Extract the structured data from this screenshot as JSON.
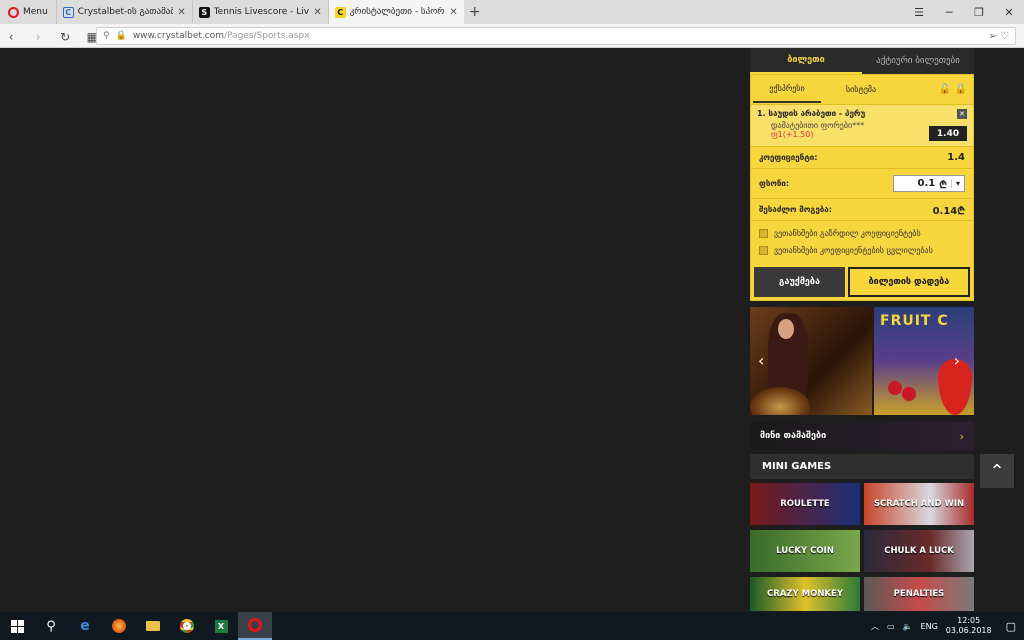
{
  "browser": {
    "menu_label": "Menu",
    "tabs": [
      {
        "title": "Crystalbet-ის გათამაშე",
        "icon": "crystalbet-favicon"
      },
      {
        "title": "Tennis Livescore - Live Sco",
        "icon": "livescore-favicon"
      },
      {
        "title": "კრისტალბეთი - სპორტ",
        "icon": "crystalbet-favicon"
      }
    ],
    "new_tab": "+",
    "url_host": "www.crystalbet.com",
    "url_path": "/Pages/Sports.aspx"
  },
  "betslip": {
    "tab_active": "ბილეთი",
    "tab_inactive": "აქტიური ბილეთები",
    "sub_tab_express": "ექსპრესი",
    "sub_tab_system": "სისტემა",
    "bet": {
      "line1": "1. საუდის არაბეთი - პერუ",
      "line2": "დამატებითი ფორები***",
      "line3": "ფ1(+1.50)",
      "odd": "1.40"
    },
    "coef_label": "კოეფიციენტი:",
    "coef_value": "1.4",
    "stake_label": "ფსონი:",
    "stake_value": "0.1",
    "win_label": "შესაძლო მოგება:",
    "win_value": "0.14",
    "check1": "ვეთანხმები გაზრდილ კოეფიციენტებს",
    "check2": "ვეთანხმები კოეფიციენტების ცვლილებას",
    "clear_label": "გაუქმება",
    "place_label": "ბილეთის დადება"
  },
  "banner": {
    "fruit_text": "FRUIT C"
  },
  "mini": {
    "header": "მინი თამაშები",
    "title": "MINI GAMES",
    "games": [
      "ROULETTE",
      "SCRATCH AND WIN",
      "LUCKY COIN",
      "CHULK A LUCK",
      "CRAZY MONKEY",
      "PENALTIES"
    ]
  },
  "taskbar": {
    "lang": "ENG",
    "time": "12:05",
    "date": "03.06.2018"
  }
}
